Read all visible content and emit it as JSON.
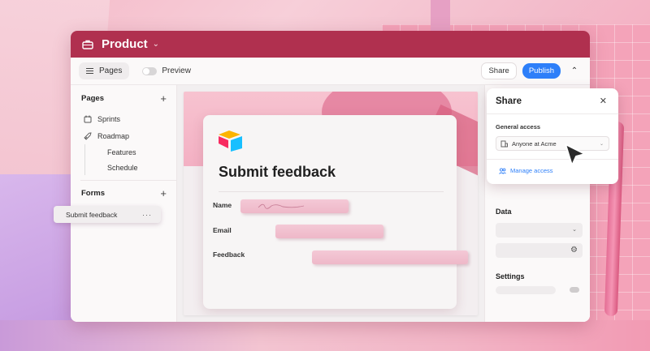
{
  "app": {
    "title": "Product"
  },
  "toolbar": {
    "pages_label": "Pages",
    "preview_label": "Preview",
    "share_label": "Share",
    "publish_label": "Publish"
  },
  "sidebar": {
    "pages_heading": "Pages",
    "items": [
      {
        "label": "Sprints",
        "icon": "calendar-icon"
      },
      {
        "label": "Roadmap",
        "icon": "rocket-icon"
      }
    ],
    "sub_items": [
      "Features",
      "Schedule"
    ],
    "forms_heading": "Forms",
    "form_item": "Submit feedback"
  },
  "form_card": {
    "title": "Submit feedback",
    "fields": [
      {
        "label": "Name"
      },
      {
        "label": "Email"
      },
      {
        "label": "Feedback"
      }
    ]
  },
  "share_popover": {
    "title": "Share",
    "general_access_label": "General access",
    "access_value": "Anyone at Acme",
    "manage_access_label": "Manage access"
  },
  "right_panel": {
    "data_label": "Data",
    "settings_label": "Settings"
  },
  "colors": {
    "titlebar": "#b0304f",
    "publish": "#2d7ff9",
    "link": "#2d7ff9"
  }
}
